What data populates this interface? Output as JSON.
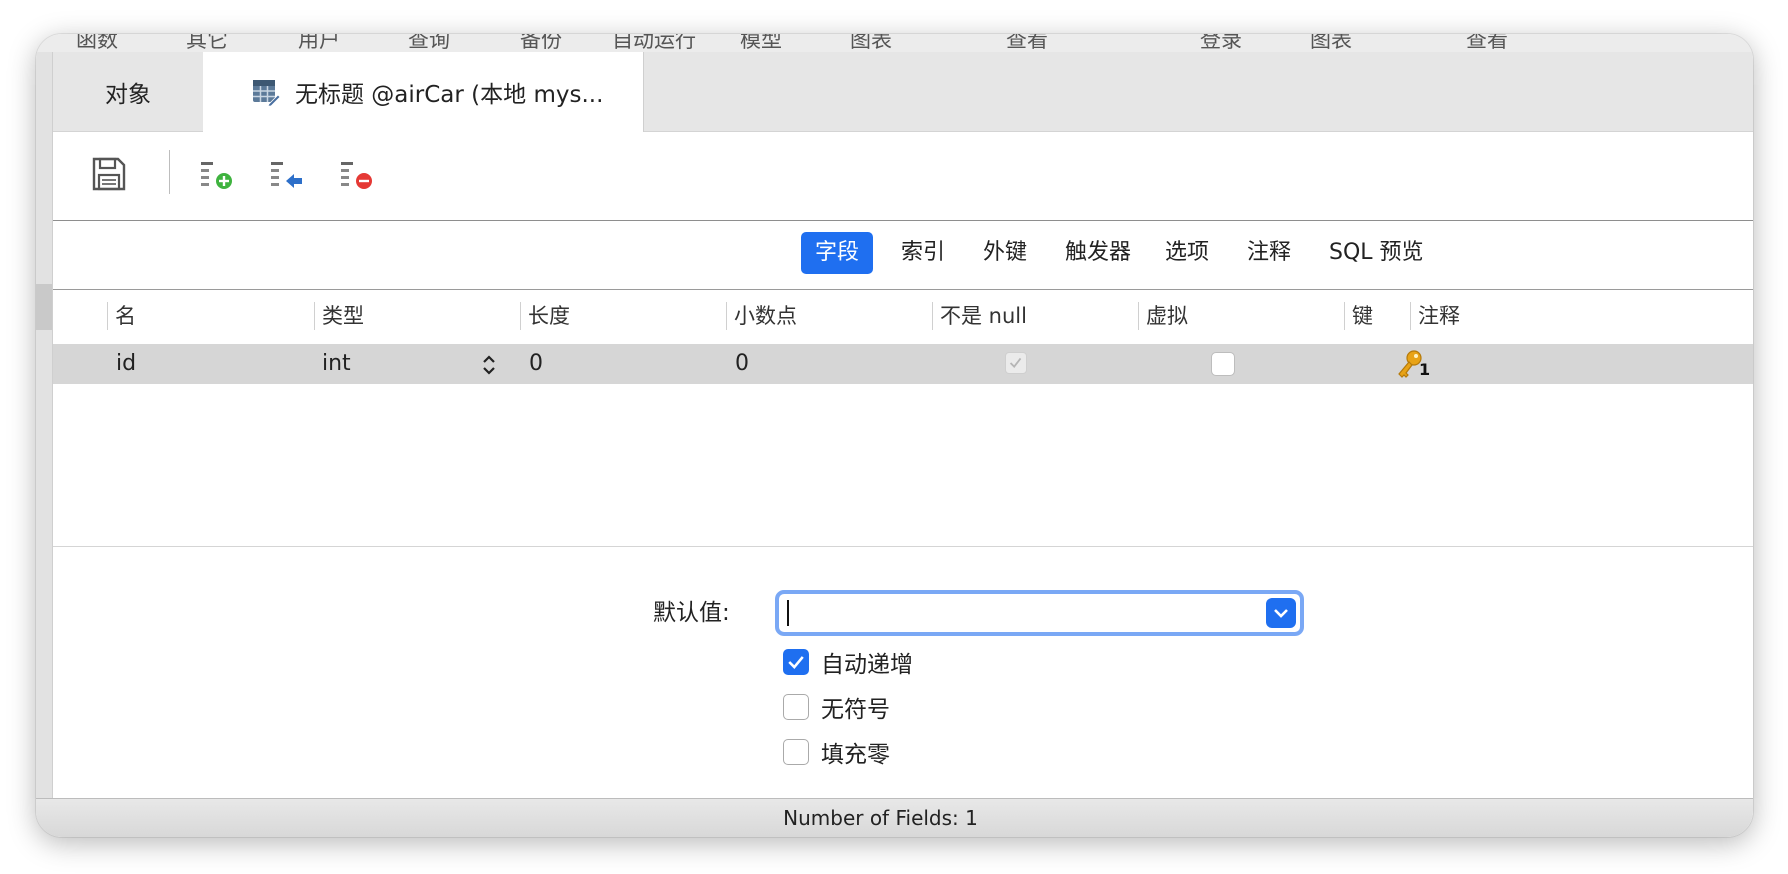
{
  "top_strip": [
    "函数",
    "其它",
    "用户",
    "查询",
    "备份",
    "自动运行",
    "模型",
    "图表",
    "查看",
    "登录",
    "图表",
    "查看"
  ],
  "tabs": {
    "objects_label": "对象",
    "active_label": "无标题 @airCar (本地 mys..."
  },
  "toolbar": {
    "save_icon": "save-icon",
    "add_field_icon": "add-field-icon",
    "insert_field_icon": "insert-field-icon",
    "delete_field_icon": "delete-field-icon"
  },
  "segments": [
    "字段",
    "索引",
    "外键",
    "触发器",
    "选项",
    "注释",
    "SQL 预览"
  ],
  "active_segment": "字段",
  "table": {
    "columns": [
      "名",
      "类型",
      "长度",
      "小数点",
      "不是 null",
      "虚拟",
      "键",
      "注释"
    ],
    "rows": [
      {
        "name": "id",
        "type": "int",
        "length": "0",
        "decimals": "0",
        "not_null": true,
        "virtual": false,
        "key_number": "1",
        "comment": ""
      }
    ]
  },
  "field_options": {
    "default_label": "默认值:",
    "default_value": "",
    "auto_increment_label": "自动递增",
    "auto_increment_checked": true,
    "unsigned_label": "无符号",
    "unsigned_checked": false,
    "zerofill_label": "填充零",
    "zerofill_checked": false
  },
  "status": {
    "text": "Number of Fields: 1"
  },
  "colors": {
    "accent": "#1f6ff0",
    "row_selected": "#d6d6d6",
    "key_gold": "#e8a317"
  }
}
